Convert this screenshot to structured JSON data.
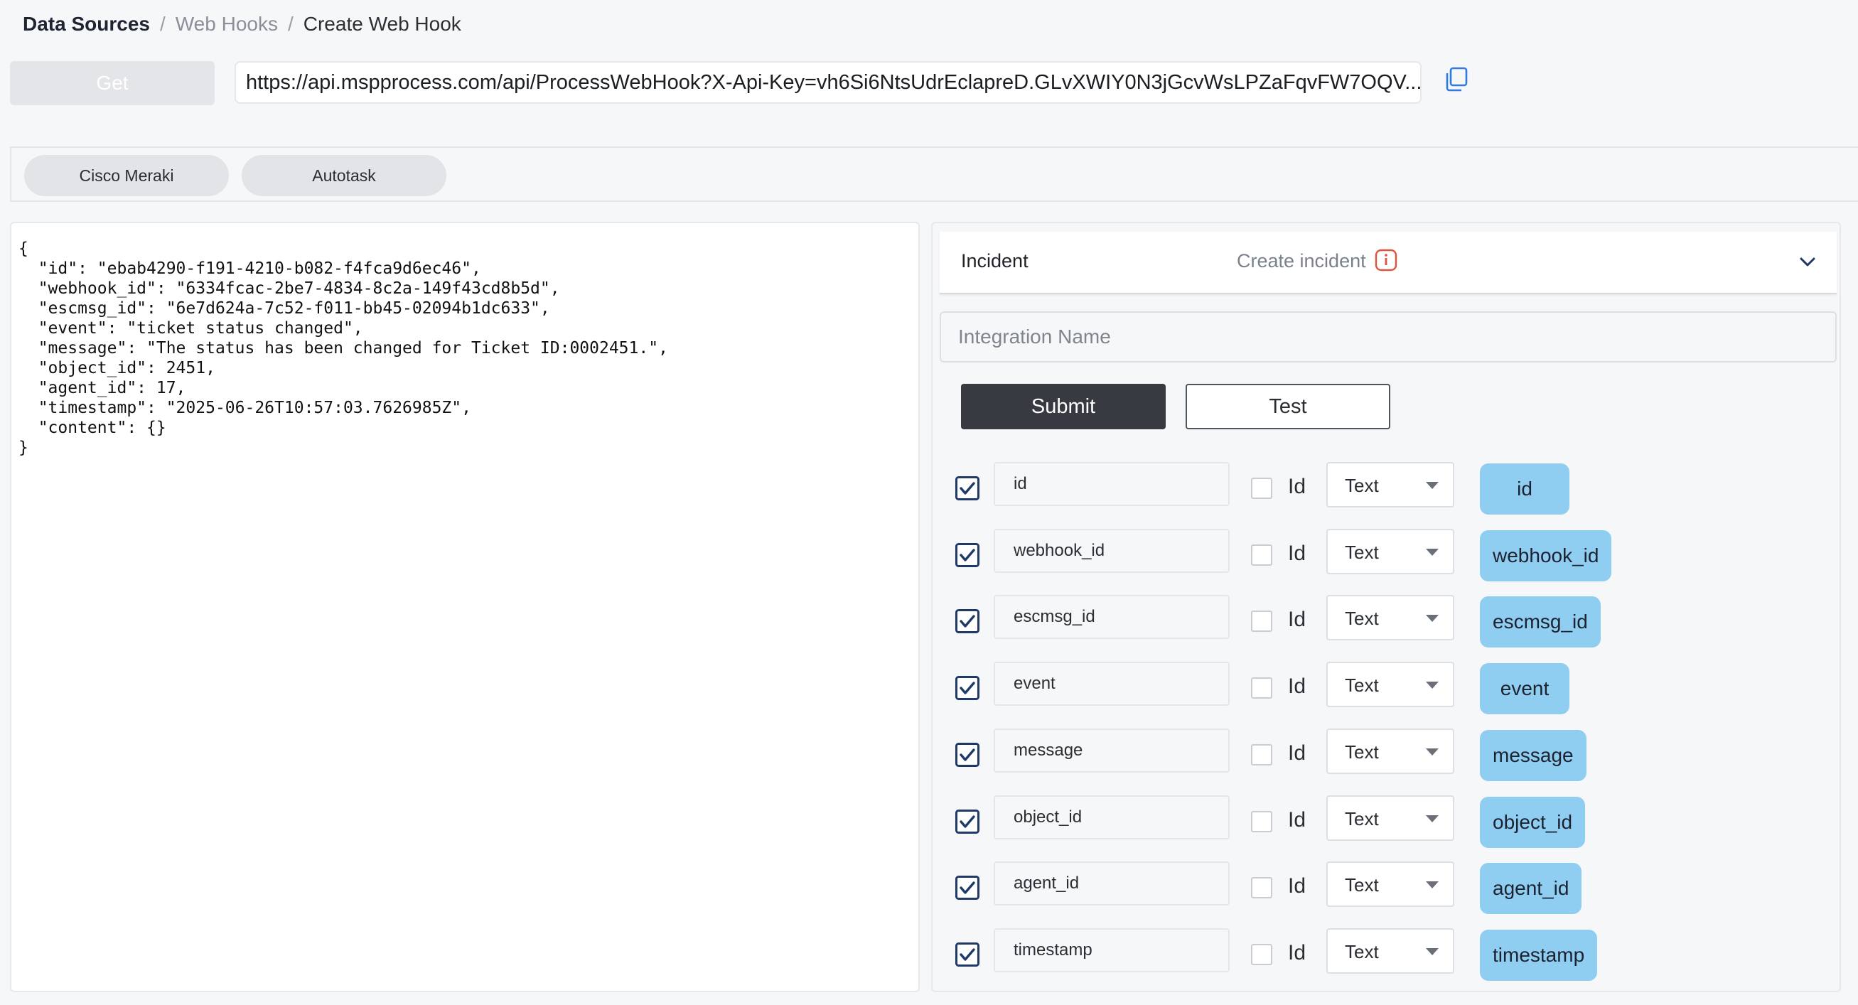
{
  "breadcrumb": {
    "root": "Data Sources",
    "sep": "/",
    "middle": "Web Hooks",
    "current": "Create Web Hook"
  },
  "toolbar": {
    "get_label": "Get",
    "url": "https://api.mspprocess.com/api/ProcessWebHook?X-Api-Key=vh6Si6NtsUdrEclapreD.GLvXWIY0N3jGcvWsLPZaFqvFW7OQV..."
  },
  "tabs": [
    {
      "label": "Cisco Meraki"
    },
    {
      "label": "Autotask"
    }
  ],
  "payload_json": "{\n  \"id\": \"ebab4290-f191-4210-b082-f4fca9d6ec46\",\n  \"webhook_id\": \"6334fcac-2be7-4834-8c2a-149f43cd8b5d\",\n  \"escmsg_id\": \"6e7d624a-7c52-f011-bb45-02094b1dc633\",\n  \"event\": \"ticket status changed\",\n  \"message\": \"The status has been changed for Ticket ID:0002451.\",\n  \"object_id\": 2451,\n  \"agent_id\": 17,\n  \"timestamp\": \"2025-06-26T10:57:03.7626985Z\",\n  \"content\": {}\n}",
  "incident": {
    "title": "Incident",
    "subtitle": "Create incident"
  },
  "form": {
    "integration_placeholder": "Integration Name",
    "submit_label": "Submit",
    "test_label": "Test"
  },
  "fields": [
    {
      "name": "id",
      "id_label": "Id",
      "type": "Text",
      "tag": "id"
    },
    {
      "name": "webhook_id",
      "id_label": "Id",
      "type": "Text",
      "tag": "webhook_id"
    },
    {
      "name": "escmsg_id",
      "id_label": "Id",
      "type": "Text",
      "tag": "escmsg_id"
    },
    {
      "name": "event",
      "id_label": "Id",
      "type": "Text",
      "tag": "event"
    },
    {
      "name": "message",
      "id_label": "Id",
      "type": "Text",
      "tag": "message"
    },
    {
      "name": "object_id",
      "id_label": "Id",
      "type": "Text",
      "tag": "object_id"
    },
    {
      "name": "agent_id",
      "id_label": "Id",
      "type": "Text",
      "tag": "agent_id"
    },
    {
      "name": "timestamp",
      "id_label": "Id",
      "type": "Text",
      "tag": "timestamp"
    }
  ],
  "colors": {
    "accent_dark": "#373a40",
    "tag_blue": "#8fcdf1",
    "checkbox_navy": "#1f3a66",
    "info_red": "#e0523b"
  }
}
